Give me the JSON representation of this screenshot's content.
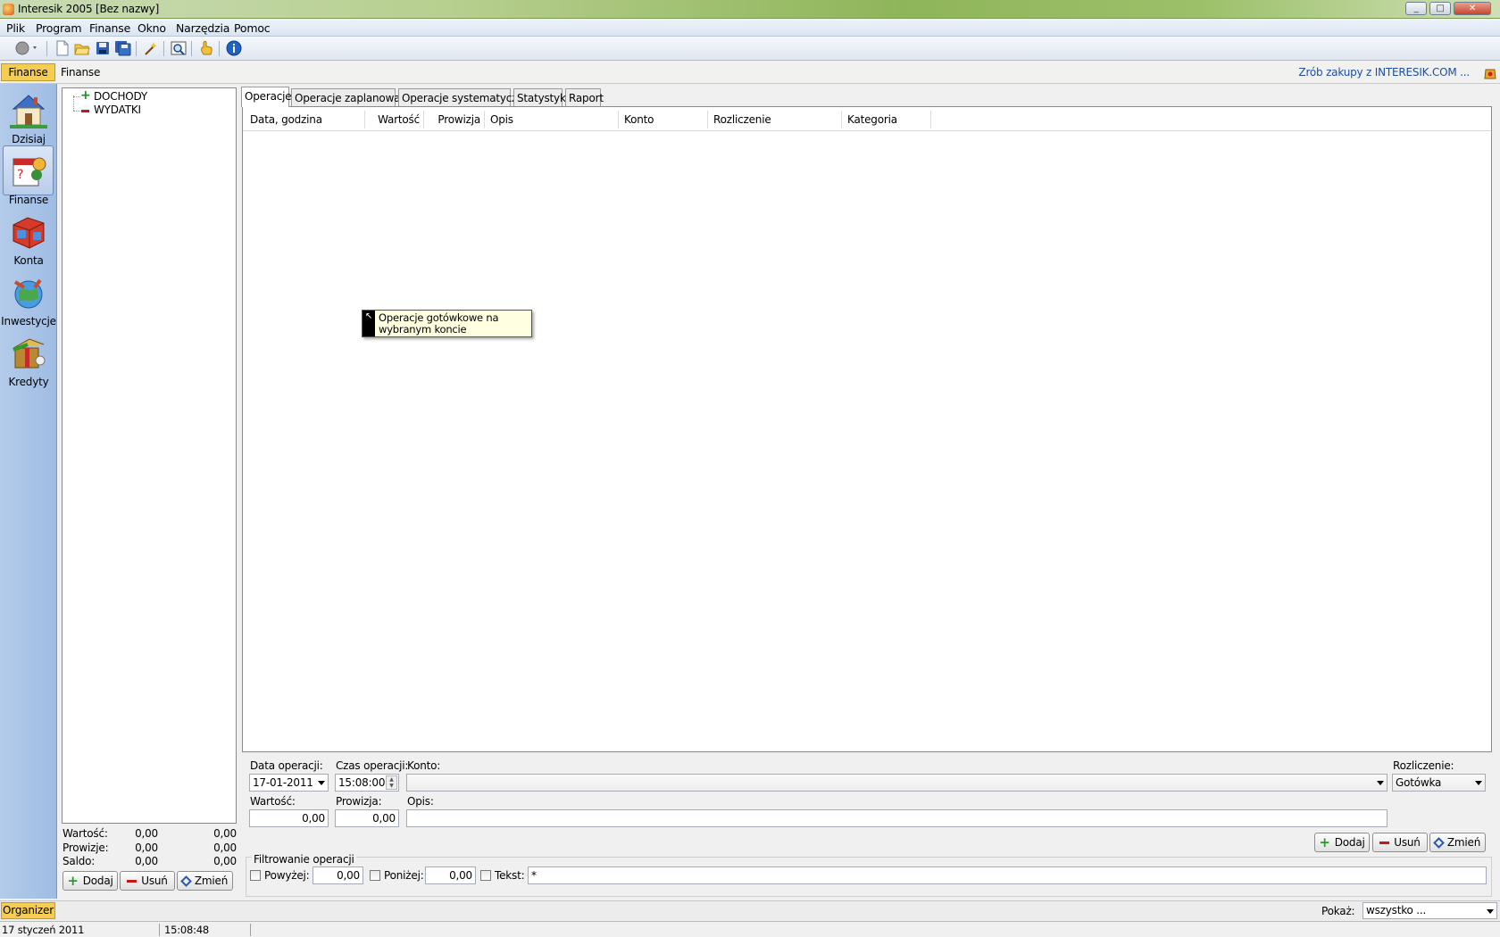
{
  "window": {
    "title": "Interesik 2005 [Bez nazwy]",
    "buttons": [
      "_",
      "□",
      "✕"
    ]
  },
  "menu": [
    "Plik",
    "Program",
    "Finanse",
    "Okno",
    "Narzędzia",
    "Pomoc"
  ],
  "toolbar": {
    "icons": [
      "record-icon",
      "new-file-icon",
      "open-folder-icon",
      "save-icon",
      "save-all-icon",
      "wand-icon",
      "preview-icon",
      "hand-icon",
      "info-icon"
    ]
  },
  "infobar": {
    "section_tab": "Finanse",
    "breadcrumb": "Finanse",
    "promo_link": "Zrób zakupy z INTERESIK.COM ..."
  },
  "nav": [
    {
      "label": "Dzisiaj",
      "icon": "house-icon"
    },
    {
      "label": "Finanse",
      "icon": "finance-calendar-icon"
    },
    {
      "label": "Konta",
      "icon": "accounts-box-icon"
    },
    {
      "label": "Inwestycje",
      "icon": "investment-globe-icon"
    },
    {
      "label": "Kredyty",
      "icon": "credit-gift-icon"
    }
  ],
  "tree": {
    "items": [
      "DOCHODY",
      "WYDATKI"
    ]
  },
  "totals": {
    "rows": [
      {
        "label": "Wartość:",
        "a": "0,00",
        "b": "0,00"
      },
      {
        "label": "Prowizje:",
        "a": "0,00",
        "b": "0,00"
      },
      {
        "label": "Saldo:",
        "a": "0,00",
        "b": "0,00"
      }
    ]
  },
  "left_buttons": {
    "add": "Dodaj",
    "remove": "Usuń",
    "edit": "Zmień"
  },
  "tabs": [
    "Operacje",
    "Operacje zaplanowane",
    "Operacje systematyczne",
    "Statystyki",
    "Raport"
  ],
  "table": {
    "columns": [
      "Data, godzina",
      "Wartość",
      "Prowizja",
      "Opis",
      "Konto",
      "Rozliczenie",
      "Kategoria"
    ]
  },
  "tooltip": {
    "text": "Operacje gotówkowe na wybranym koncie"
  },
  "form": {
    "date_label": "Data operacji:",
    "date_value": "17-01-2011",
    "time_label": "Czas operacji:",
    "time_value": "15:08:00",
    "account_label": "Konto:",
    "account_value": "",
    "settlement_label": "Rozliczenie:",
    "settlement_value": "Gotówka",
    "value_label": "Wartość:",
    "value_value": "0,00",
    "commission_label": "Prowizja:",
    "commission_value": "0,00",
    "description_label": "Opis:",
    "description_value": "",
    "add": "Dodaj",
    "remove": "Usuń",
    "edit": "Zmień"
  },
  "filter": {
    "title": "Filtrowanie operacji",
    "above_label": "Powyżej:",
    "above_value": "0,00",
    "below_label": "Poniżej:",
    "below_value": "0,00",
    "text_label": "Tekst:",
    "text_value": "*"
  },
  "bottombar": {
    "organizer_tab": "Organizer",
    "show_label": "Pokaż:",
    "show_value": "wszystko ..."
  },
  "status": {
    "date": "17 styczeń 2011",
    "time": "15:08:48"
  }
}
